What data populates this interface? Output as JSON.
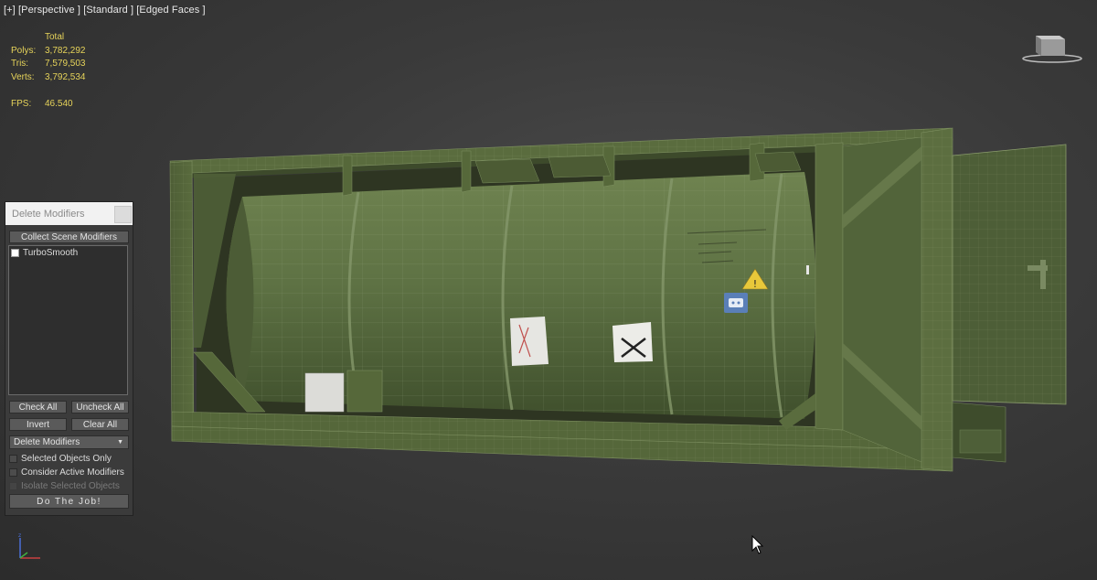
{
  "viewport": {
    "labels": [
      "[+]",
      "[Perspective ]",
      "[Standard ]",
      "[Edged Faces ]"
    ]
  },
  "stats": {
    "header": "Total",
    "rows": [
      {
        "key": "Polys:",
        "value": "3,782,292"
      },
      {
        "key": "Tris:",
        "value": "7,579,503"
      },
      {
        "key": "Verts:",
        "value": "3,792,534"
      }
    ],
    "fps_label": "FPS:",
    "fps_value": "46.540"
  },
  "panel": {
    "title": "Delete Modifiers",
    "collect_button": "Collect Scene Modifiers",
    "list_items": [
      "TurboSmooth"
    ],
    "check_all": "Check All",
    "uncheck_all": "Uncheck All",
    "invert": "Invert",
    "clear_all": "Clear All",
    "mode_dropdown": "Delete Modifiers",
    "opt_selected_only": "Selected Objects Only",
    "opt_consider_active": "Consider Active Modifiers",
    "opt_isolate": "Isolate Selected Objects",
    "do_job": "Do The Job!"
  },
  "colors": {
    "stats_yellow": "#e6d35a",
    "container_green": "#56683a",
    "viewport_bg": "#3a3a3a"
  },
  "icons": {
    "warning": "warning-triangle-icon",
    "viewcube": "viewcube-icon",
    "axis": "axis-gizmo-icon",
    "cursor": "mouse-cursor-icon"
  }
}
